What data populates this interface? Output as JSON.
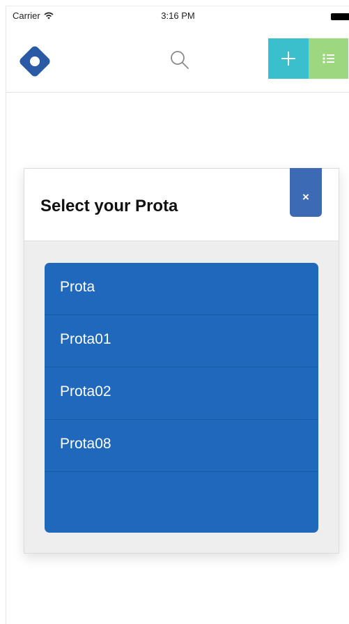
{
  "status_bar": {
    "carrier": "Carrier",
    "time": "3:16 PM",
    "wifi_icon": "wifi-icon",
    "battery_icon": "battery-icon"
  },
  "header": {
    "logo_icon": "diamond-logo-icon",
    "search_icon": "search-icon",
    "add_icon": "plus-icon",
    "list_icon": "list-icon",
    "colors": {
      "add_button": "#3bbfcd",
      "list_button": "#9dd77f",
      "logo": "#2a5aa6"
    }
  },
  "modal": {
    "title": "Select your Prota",
    "close_label": "×",
    "close_color": "#3c6ab4",
    "list_color": "#1f68bc",
    "options": [
      {
        "label": "Prota"
      },
      {
        "label": "Prota01"
      },
      {
        "label": "Prota02"
      },
      {
        "label": "Prota08"
      },
      {
        "label": ""
      }
    ]
  }
}
